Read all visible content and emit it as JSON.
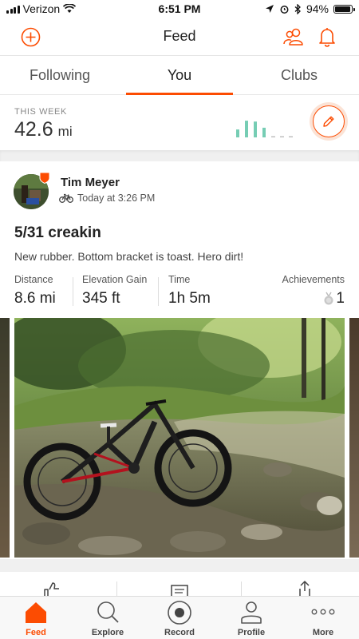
{
  "status_bar": {
    "carrier": "Verizon",
    "time": "6:51 PM",
    "battery_percent": "94%",
    "battery_level": 0.94,
    "icons": [
      "signal-icon",
      "wifi-icon",
      "location-icon",
      "alarm-icon",
      "bluetooth-icon",
      "battery-icon"
    ]
  },
  "nav": {
    "title": "Feed",
    "icons": [
      "add-icon",
      "athletes-icon",
      "bell-icon"
    ]
  },
  "tabs": [
    {
      "label": "Following",
      "active": false
    },
    {
      "label": "You",
      "active": true
    },
    {
      "label": "Clubs",
      "active": false
    }
  ],
  "this_week": {
    "label": "THIS WEEK",
    "distance": "42.6",
    "unit": "mi",
    "day_bars": [
      0.45,
      0.95,
      0.9,
      0.55,
      0,
      0,
      0
    ],
    "icons": [
      "pencil-icon"
    ]
  },
  "activity": {
    "athlete": "Tim Meyer",
    "time": "Today at 3:26 PM",
    "title": "5/31 creakin",
    "description": "New rubber. Bottom bracket is toast. Hero dirt!",
    "stats": [
      {
        "label": "Distance",
        "value": "8.6 mi"
      },
      {
        "label": "Elevation Gain",
        "value": "345 ft"
      },
      {
        "label": "Time",
        "value": "1h 5m"
      }
    ],
    "achievements": {
      "label": "Achievements",
      "value": "1"
    },
    "icons": [
      "avatar-photo",
      "bike-icon",
      "medal-icon",
      "like-icon",
      "comment-icon",
      "share-icon"
    ]
  },
  "bottom_tabs": [
    {
      "label": "Feed",
      "icon": "home-icon",
      "active": true
    },
    {
      "label": "Explore",
      "icon": "search-icon",
      "active": false
    },
    {
      "label": "Record",
      "icon": "record-icon",
      "active": false
    },
    {
      "label": "Profile",
      "icon": "person-icon",
      "active": false
    },
    {
      "label": "More",
      "icon": "more-icon",
      "active": false
    }
  ],
  "colors": {
    "accent": "#fc4c02",
    "week_bars": "#76cdb4"
  }
}
